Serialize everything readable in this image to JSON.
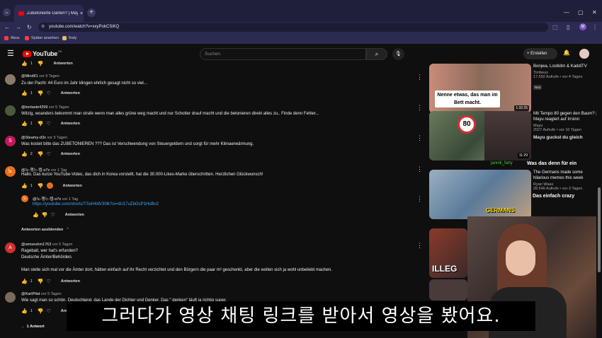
{
  "browser": {
    "tab_title": "Zubetonierte Gärten? | Mayu r",
    "url": "youtube.com/watch?v=xxyPokCSiKQ",
    "bookmarks": [
      "Abos",
      "Später ansehen",
      "Ihsly"
    ],
    "profile_initial": "M"
  },
  "youtube": {
    "logo": "YouTube",
    "logo_region": "DE",
    "search_placeholder": "Suchen",
    "create_label": "Erstellen"
  },
  "comments": [
    {
      "author": "@Mind91",
      "ago": "vor 6 Tagen",
      "text": "Zu der Pacht: 44 Euro im Jahr klingen ehrlich gesagt nicht so viel...",
      "likes": "1",
      "reply": "Antworten",
      "avatar_color": "#8a7a6a",
      "avatar_letter": ""
    },
    {
      "author": "@tontaste4299",
      "ago": "vor 5 Tagen",
      "text": "Witzig, woanders bekommt man strafe wenn man alles grüne weg macht und nur Schotter drauf macht und die betonieren direkt alles zu..  Finde denn Fehler...",
      "likes": "1",
      "reply": "Antworten",
      "avatar_color": "#4a5a3a",
      "avatar_letter": ""
    },
    {
      "author": "@Steamy-d3x",
      "ago": "vor 5 Tagen",
      "text": "Was kostet bitte das ZUBETONIEREN ??? Das ist Verschwendung von Steuergeldern und sorgt für mehr Klimaerwärmung.",
      "likes": "2",
      "reply": "Antworten",
      "avatar_color": "#c2185b",
      "avatar_letter": "S"
    },
    {
      "author": "@노-챙느-탭-o7x",
      "ago": "vor 1 Tag",
      "text": "Hallo. Das kurze YouTube-Video, das dich in Korea vorstellt, hat die 30.000-Likes-Marke überschritten. Herzlichen Glückwunsch!",
      "likes": "1",
      "reply": "Antworten",
      "avatar_color": "#e8711a",
      "avatar_letter": "노"
    },
    {
      "author": "@노-챙느-탭-o7x",
      "ago": "vor 1 Tag",
      "text": "https://youtube.com/shorts/TSoH4dV30lk?si=dU17uZbGcP1HoBv2",
      "likes": "",
      "reply": "Antworten",
      "avatar_color": "#e8711a",
      "avatar_letter": "노"
    },
    {
      "author": "@amoeuhm1763",
      "ago": "vor 5 Tagen",
      "line1": "Ragebait, wer hat's erfunden?",
      "line2": "Deutsche Ämter/Behörden.",
      "line3": "Man stelle sich mal vor die Ämter dort, hätten einfach auf ihr Recht verzichtet und den Bürgern die paar m² geschenkt, aber die wollen sich ja wohl unbeliebt machen.",
      "likes": "1",
      "reply": "Antworten",
      "avatar_color": "#d32f2f",
      "avatar_letter": "A"
    },
    {
      "author": "@KartPilat",
      "ago": "vor 5 Tagen",
      "text": "Wie sagt man so schön. Deutschland, das Lande der Dichter und Denker. Das \" denken\" läuft ja richtig super.",
      "likes": "1",
      "reply": "Antworten",
      "avatar_color": "#7a6a5a",
      "avatar_letter": ""
    }
  ],
  "hide_replies": "Antworten ausblenden",
  "replies_count": "1 Antwort",
  "sidebar": [
    {
      "title": "Bonjwa, Lostkitm & KaddiTV",
      "channel": "Timbeus",
      "views": "17.592 Aufrufe • vor 4 Tagen",
      "badge": "Neu",
      "duration": "1:32:25",
      "overlay": "Nenne etwas, das man im Bett macht."
    },
    {
      "title": "Mit Tempo 80 gegen den Baum? | Mayu reagiert auf Irrsinn",
      "channel": "Mayu",
      "views": "2027 Aufrufe • vor 10 Tagen",
      "badge": "",
      "duration": "11:29",
      "overlay": "Mayu guckst du gleich"
    },
    {
      "title": "The Germans made some hilarious memes this week",
      "channel": "Ryan Waas",
      "views": "28.546 Aufrufe • vor 3 Tagen",
      "badge": "",
      "duration": "",
      "overlay": "Was das denn für ein"
    },
    {
      "title": "",
      "channel": "",
      "views": "",
      "badge": "",
      "duration": "",
      "overlay": "ILLEG"
    }
  ],
  "stream_chat": [
    "Was das denn für ein",
    "Das einfach crazy",
    "jannik_farty"
  ],
  "sign_80": "80",
  "thumb_texts": {
    "germans": "GERMANS",
    "bett": "Mayu guckst du gleich"
  },
  "subtitle": "그러다가 영상 채팅 링크를 받아서 영상을 봤어요."
}
